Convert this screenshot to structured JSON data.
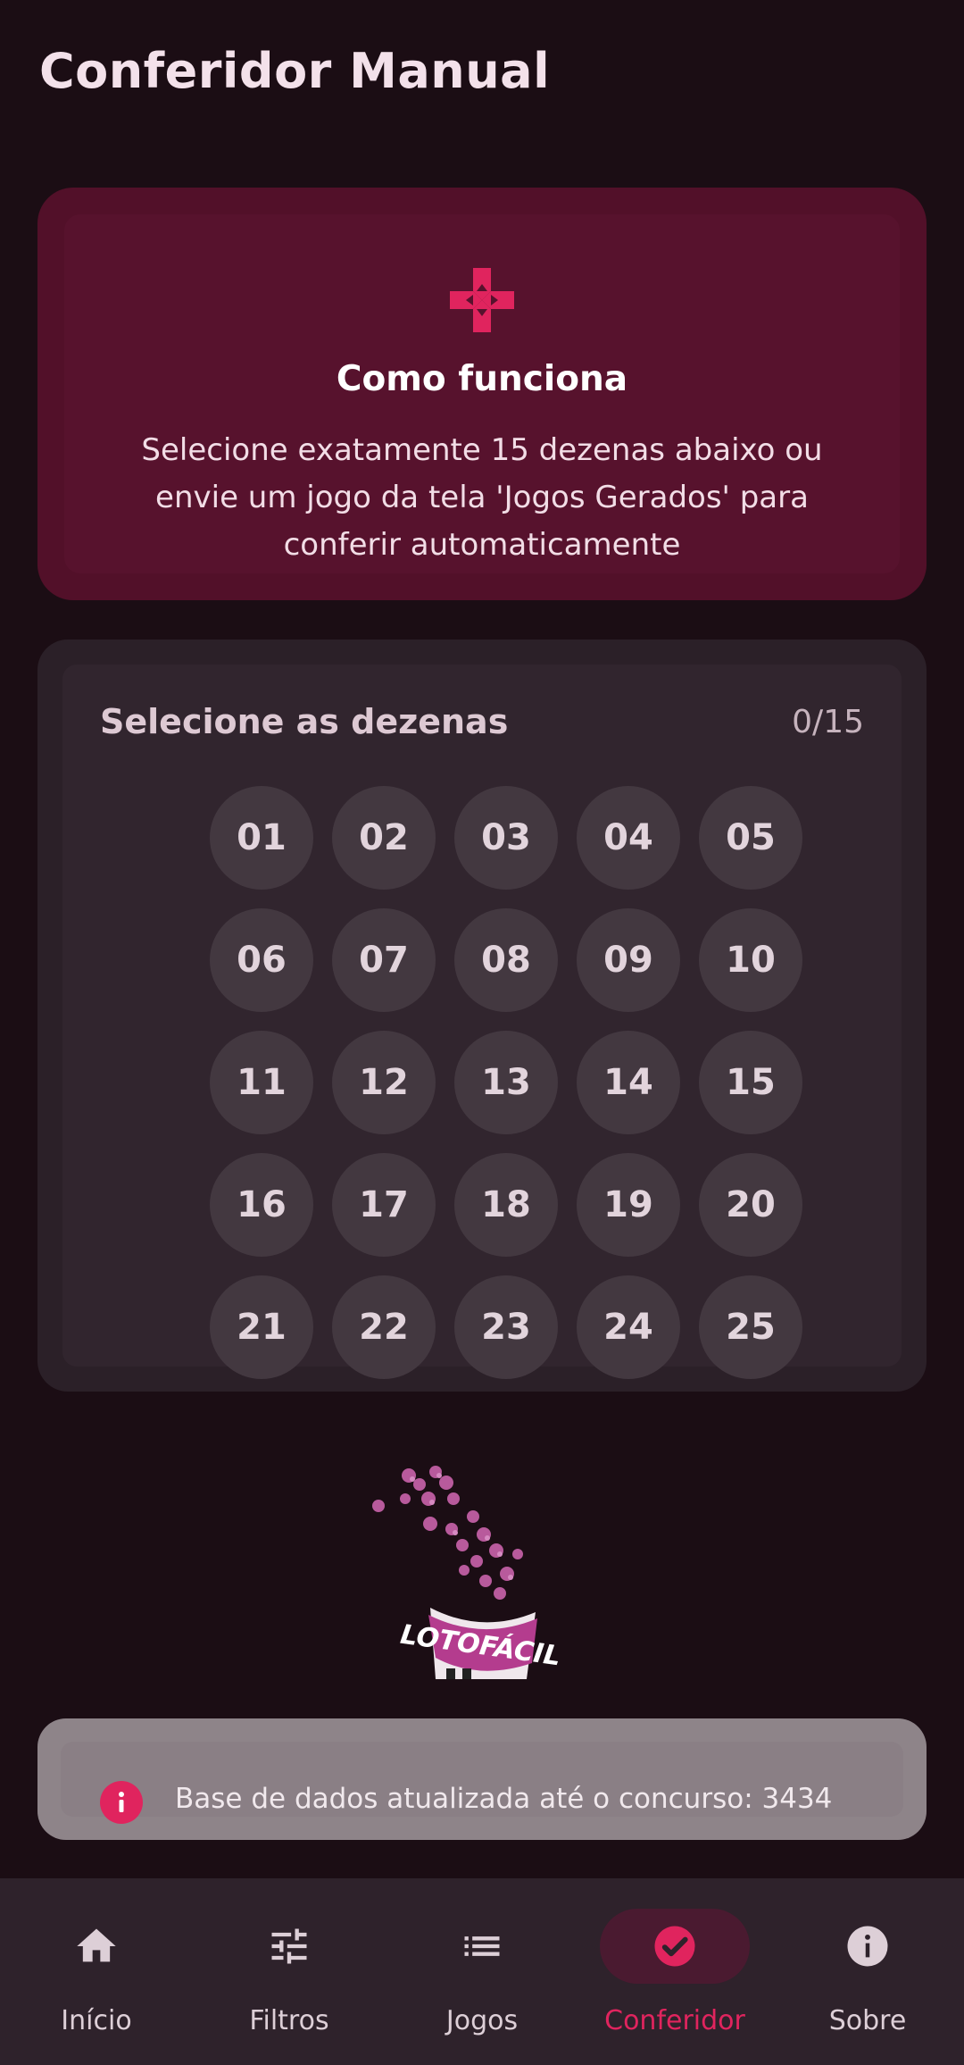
{
  "header": {
    "title": "Conferidor Manual"
  },
  "info": {
    "icon": "gamepad-cross-icon",
    "heading": "Como funciona",
    "text": "Selecione exatamente 15 dezenas abaixo ou envie um jogo da tela 'Jogos Gerados' para conferir automaticamente"
  },
  "selector": {
    "title": "Selecione as dezenas",
    "count": "0/15",
    "numbers": [
      "01",
      "02",
      "03",
      "04",
      "05",
      "06",
      "07",
      "08",
      "09",
      "10",
      "11",
      "12",
      "13",
      "14",
      "15",
      "16",
      "17",
      "18",
      "19",
      "20",
      "21",
      "22",
      "23",
      "24",
      "25"
    ]
  },
  "illustration": {
    "label": "LOTOFÁCIL"
  },
  "status": {
    "icon": "info-icon",
    "text": "Base de dados atualizada até o concurso: 3434"
  },
  "nav": {
    "items": [
      {
        "label": "Início",
        "icon": "home-icon",
        "active": false
      },
      {
        "label": "Filtros",
        "icon": "sliders-icon",
        "active": false
      },
      {
        "label": "Jogos",
        "icon": "list-icon",
        "active": false
      },
      {
        "label": "Conferidor",
        "icon": "check-circle-icon",
        "active": true
      },
      {
        "label": "Sobre",
        "icon": "info-icon",
        "active": false
      }
    ]
  },
  "colors": {
    "accent": "#e0245e",
    "background": "#1b0d14",
    "info_card": "#521029",
    "number_bg": "#433840"
  }
}
